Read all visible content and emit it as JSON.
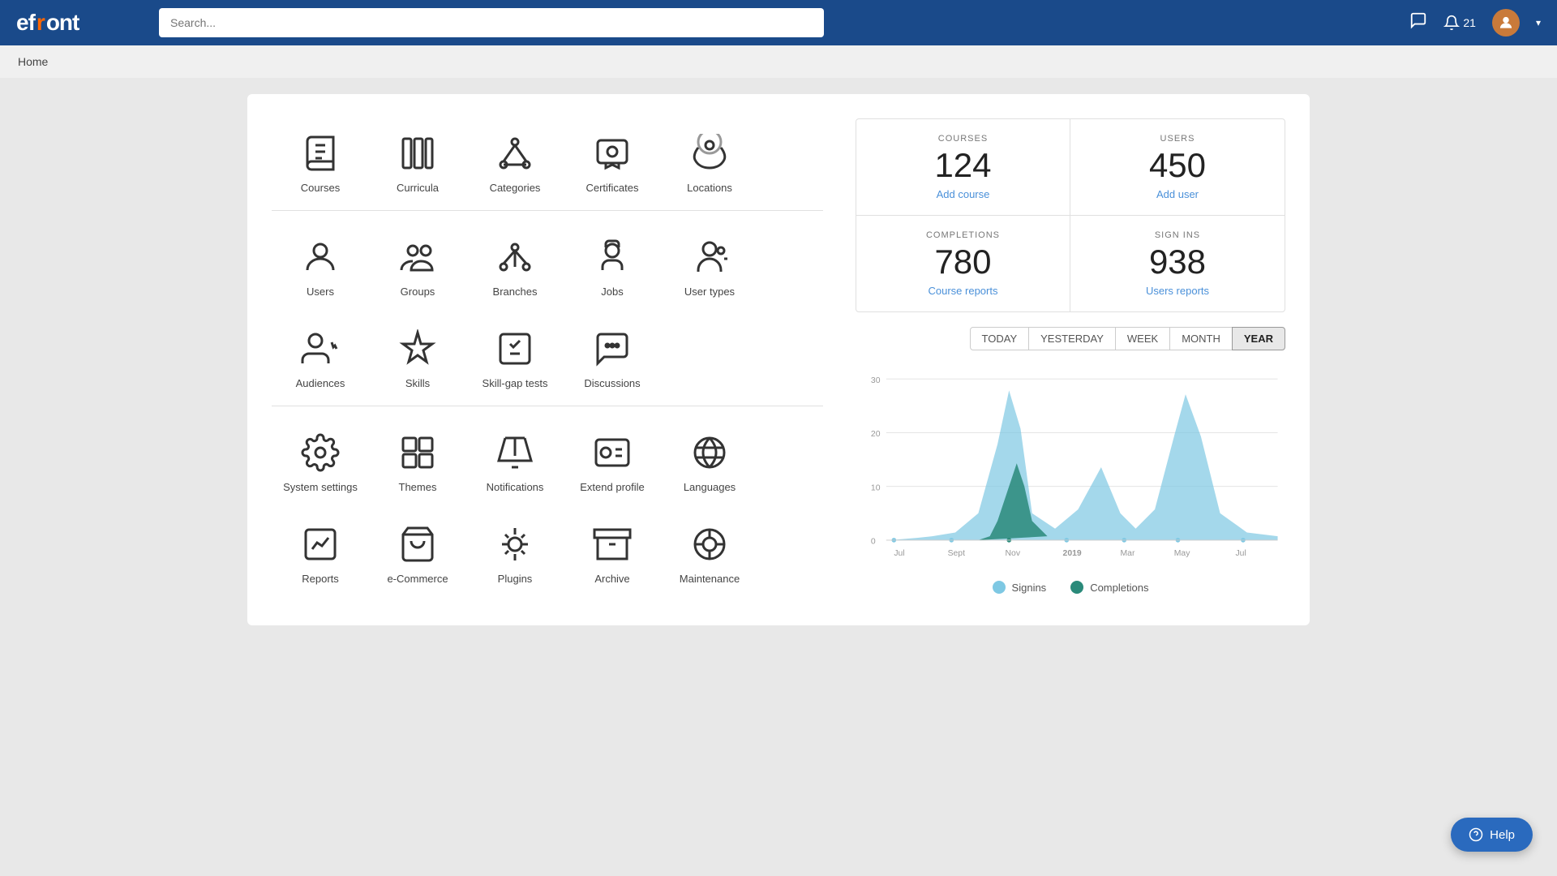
{
  "header": {
    "logo": "efront",
    "search_placeholder": "Search...",
    "notifications_count": "21",
    "user_dropdown_label": "▾"
  },
  "breadcrumb": "Home",
  "stats": {
    "courses_label": "COURSES",
    "courses_count": "124",
    "courses_link": "Add course",
    "users_label": "USERS",
    "users_count": "450",
    "users_link": "Add user",
    "completions_label": "COMPLETIONS",
    "completions_count": "780",
    "completions_link": "Course reports",
    "signins_label": "SIGN INS",
    "signins_count": "938",
    "signins_link": "Users reports"
  },
  "chart_tabs": [
    "TODAY",
    "YESTERDAY",
    "WEEK",
    "MONTH",
    "YEAR"
  ],
  "chart_active_tab": "YEAR",
  "chart_x_labels": [
    "Jul",
    "Sept",
    "Nov",
    "2019",
    "Mar",
    "May",
    "Jul"
  ],
  "chart_y_labels": [
    "0",
    "10",
    "20",
    "30"
  ],
  "legend": {
    "signins_label": "Signins",
    "signins_color": "#7ec8e3",
    "completions_label": "Completions",
    "completions_color": "#2a8a7a"
  },
  "menu_items": [
    {
      "id": "courses",
      "label": "Courses"
    },
    {
      "id": "curricula",
      "label": "Curricula"
    },
    {
      "id": "categories",
      "label": "Categories"
    },
    {
      "id": "certificates",
      "label": "Certificates"
    },
    {
      "id": "locations",
      "label": "Locations"
    },
    {
      "id": "users",
      "label": "Users"
    },
    {
      "id": "groups",
      "label": "Groups"
    },
    {
      "id": "branches",
      "label": "Branches"
    },
    {
      "id": "jobs",
      "label": "Jobs"
    },
    {
      "id": "user-types",
      "label": "User types"
    },
    {
      "id": "audiences",
      "label": "Audiences"
    },
    {
      "id": "skills",
      "label": "Skills"
    },
    {
      "id": "skill-gap-tests",
      "label": "Skill-gap tests"
    },
    {
      "id": "discussions",
      "label": "Discussions"
    },
    {
      "id": "system-settings",
      "label": "System settings"
    },
    {
      "id": "themes",
      "label": "Themes"
    },
    {
      "id": "notifications",
      "label": "Notifications"
    },
    {
      "id": "extend-profile",
      "label": "Extend profile"
    },
    {
      "id": "languages",
      "label": "Languages"
    },
    {
      "id": "reports",
      "label": "Reports"
    },
    {
      "id": "ecommerce",
      "label": "e-Commerce"
    },
    {
      "id": "plugins",
      "label": "Plugins"
    },
    {
      "id": "archive",
      "label": "Archive"
    },
    {
      "id": "maintenance",
      "label": "Maintenance"
    }
  ],
  "help_button_label": "Help"
}
